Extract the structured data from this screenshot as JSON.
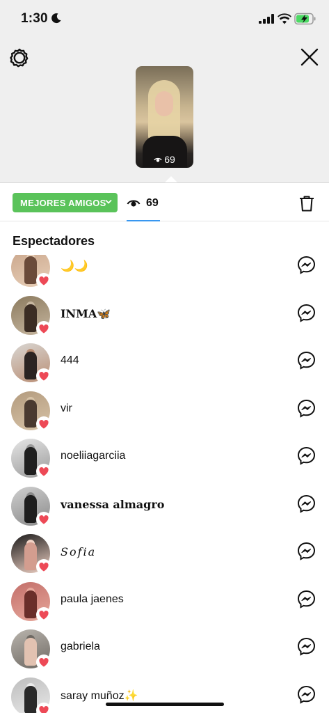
{
  "status_bar": {
    "time": "1:30"
  },
  "story": {
    "view_count": "69"
  },
  "tabs": {
    "audience_label": "MEJORES AMIGOS",
    "view_count": "69"
  },
  "viewers_title": "Espectadores",
  "viewers": [
    {
      "name": "🌙🌙",
      "style": "plain",
      "avatar_colors": [
        "#c9a58a",
        "#6b4b3a",
        "#e8cfb8"
      ]
    },
    {
      "name": "INMA🦋",
      "style": "serif",
      "avatar_colors": [
        "#8b7a5e",
        "#3b2d24",
        "#c7b7a0"
      ]
    },
    {
      "name": "444",
      "style": "plain",
      "avatar_colors": [
        "#d9d6d2",
        "#2b2422",
        "#b98e74"
      ]
    },
    {
      "name": "vir",
      "style": "plain",
      "avatar_colors": [
        "#b39b7e",
        "#4a3a30",
        "#d7c3a7"
      ]
    },
    {
      "name": "noeliiagarciia",
      "style": "plain",
      "avatar_colors": [
        "#e6e6e6",
        "#202020",
        "#9a9a9a"
      ]
    },
    {
      "name": "vanessa almagro",
      "style": "serif",
      "avatar_colors": [
        "#cfcfcf",
        "#1e1e1e",
        "#8a8a8a"
      ]
    },
    {
      "name": "𝑆𝑜𝑓𝑖𝑎",
      "style": "script",
      "avatar_colors": [
        "#1a1a1a",
        "#d39d8f",
        "#f1d3c6"
      ]
    },
    {
      "name": "paula jaenes",
      "style": "plain",
      "avatar_colors": [
        "#c36f6a",
        "#6a2e2a",
        "#e7a89c"
      ]
    },
    {
      "name": "gabriela",
      "style": "plain",
      "avatar_colors": [
        "#b9b4ad",
        "#e2c2b1",
        "#6e6963"
      ]
    },
    {
      "name": "saray muñoz✨",
      "style": "plain",
      "avatar_colors": [
        "#bdbdbd",
        "#2a2a2a",
        "#eaeaea"
      ]
    }
  ],
  "colors": {
    "best_friends_green": "#5ac35a",
    "heart_red": "#ed4956",
    "tab_underline": "#3897f0"
  }
}
